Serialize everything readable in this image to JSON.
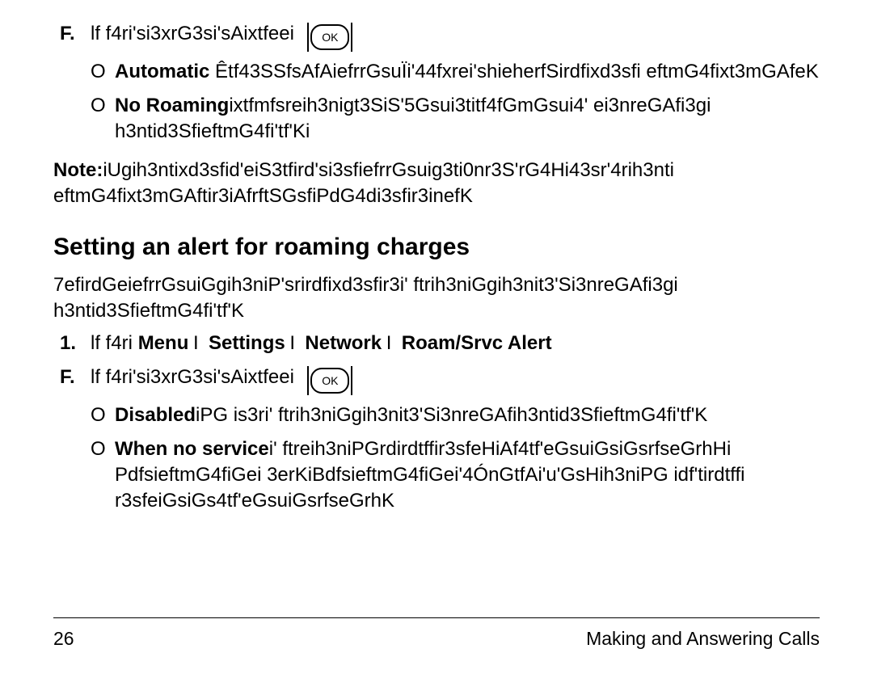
{
  "top": {
    "item2": {
      "marker": "F.",
      "lead": "lf f4ri'si3xrG3si'sAixtfeei",
      "ok": "OK",
      "sub": [
        {
          "marker": "O",
          "bold": "Automatic",
          "rest": " Êtf43SSfsAfAiefrrGsuÏi'44fxrei'shieherfSirdfixd3sfi eftmG4fixt3mGAfeK"
        },
        {
          "marker": "O",
          "bold": "No Roaming",
          "rest": "ixtfmfsreih3nigt3SiS'5Gsui3titf4fGmGsui4'  ei3nreGAfi3gi h3ntid3SfieftmG4fi'tf'Ki"
        }
      ]
    },
    "note": {
      "bold": "Note:",
      "rest": "iUgih3ntixd3sfid'eiS3tfird'si3sfiefrrGsuig3ti0nr3S'rG4Hi43sr'4rih3nti eftmG4fixt3mGAftir3iAfrftSGsfiPdG4di3sfir3inefK"
    }
  },
  "section_heading": "Setting an alert for roaming charges",
  "section_intro": "7efirdGeiefrrGsuiGgih3niP'srirdfixd3sfir3i' ftrih3niGgih3nit3'Si3nreGAfi3gi h3ntid3SfieftmG4fi'tf'K",
  "steps": {
    "s1": {
      "marker": "1.",
      "lead": "lf f4ri",
      "chain": [
        "Menu",
        "Settings",
        "Network",
        "Roam/Srvc Alert"
      ],
      "sep": "I"
    },
    "s2": {
      "marker": "F.",
      "lead": "lf f4ri'si3xrG3si'sAixtfeei",
      "ok": "OK",
      "sub": [
        {
          "marker": "O",
          "bold": "Disabled",
          "rest": "iPG  is3ri' ftrih3niGgih3nit3'Si3nreGAfih3ntid3SfieftmG4fi'tf'K"
        },
        {
          "marker": "O",
          "bold": "When no service",
          "rest": "i' ftreih3niPGrdirdtffir3sfeHiAf4tf'eGsuiGsiGsrfseGrhHi PdfsieftmG4fiGei 3erKiBdfsieftmG4fiGei'4ÓnGtfAi'u'GsHih3niPG  idf'tirdtffi r3sfeiGsiGs4tf'eGsuiGsrfseGrhK"
        }
      ]
    }
  },
  "footer": {
    "page": "26",
    "title": "Making and Answering Calls"
  }
}
